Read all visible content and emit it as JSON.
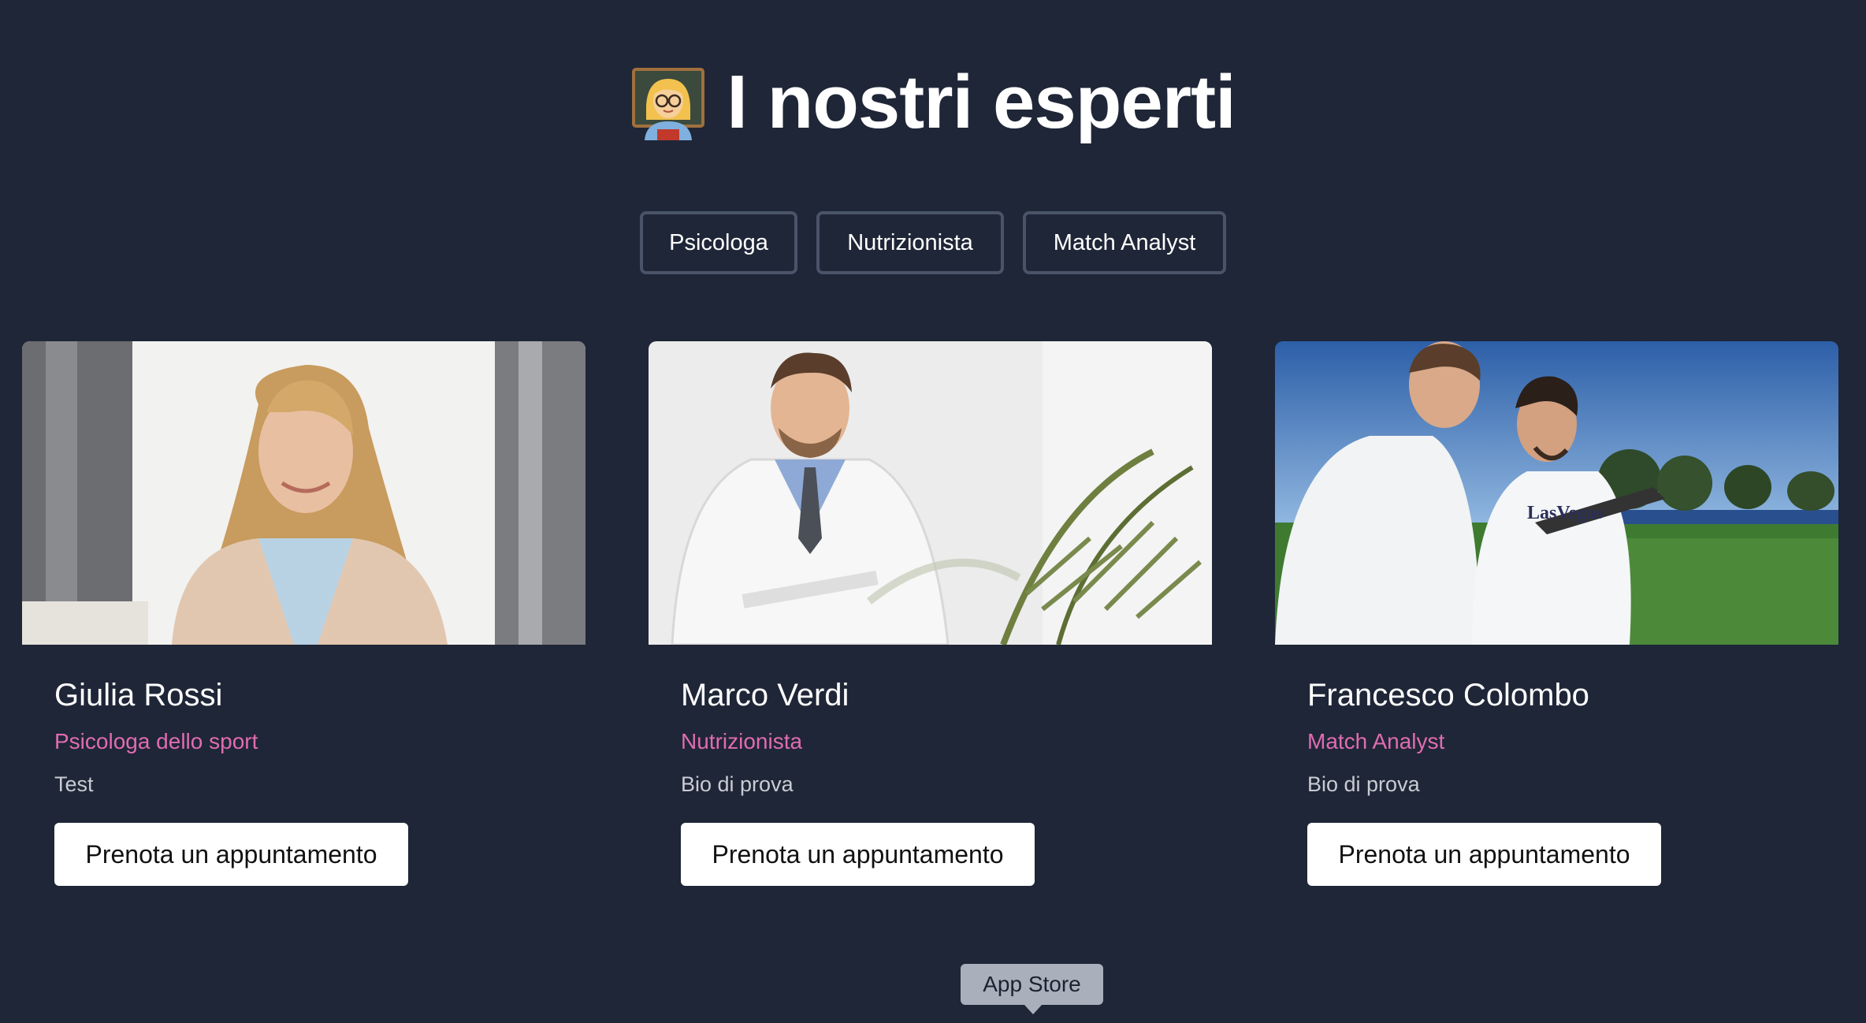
{
  "header": {
    "emoji": "👩‍🏫",
    "title": "I nostri esperti"
  },
  "filters": [
    {
      "label": "Psicologa"
    },
    {
      "label": "Nutrizionista"
    },
    {
      "label": "Match Analyst"
    }
  ],
  "experts": [
    {
      "name": "Giulia Rossi",
      "role": "Psicologa dello sport",
      "bio": "Test",
      "button": "Prenota un appuntamento",
      "photo_icon": "woman-portrait-photo"
    },
    {
      "name": "Marco Verdi",
      "role": "Nutrizionista",
      "bio": "Bio di prova",
      "button": "Prenota un appuntamento",
      "photo_icon": "doctor-portrait-photo"
    },
    {
      "name": "Francesco Colombo",
      "role": "Match Analyst",
      "bio": "Bio di prova",
      "button": "Prenota un appuntamento",
      "photo_icon": "football-analysts-photo"
    }
  ],
  "tooltip": {
    "label": "App Store"
  },
  "colors": {
    "background": "#1f2637",
    "accent": "#e06cb3",
    "filter_border": "#4a5468",
    "button_bg": "#ffffff",
    "tooltip_bg": "#a9b0bc"
  }
}
